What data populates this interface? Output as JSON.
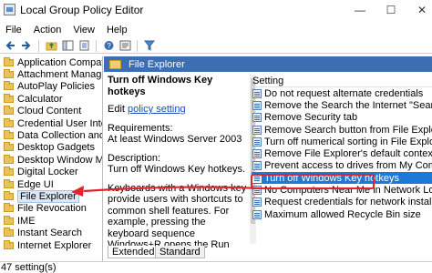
{
  "window": {
    "title": "Local Group Policy Editor",
    "minimize": "—",
    "maximize": "☐",
    "close": "✕"
  },
  "menu": [
    "File",
    "Action",
    "View",
    "Help"
  ],
  "toolbar": {
    "buttons": [
      "back",
      "forward",
      "up",
      "show-hide-tree",
      "export-list",
      "properties",
      "help",
      "filter"
    ]
  },
  "tree": {
    "items": [
      "Application Compati",
      "Attachment Manager",
      "AutoPlay Policies",
      "Calculator",
      "Cloud Content",
      "Credential User Interf",
      "Data Collection and P",
      "Desktop Gadgets",
      "Desktop Window Mai",
      "Digital Locker",
      "Edge UI",
      "File Explorer",
      "File Revocation",
      "IME",
      "Instant Search",
      "Internet Explorer"
    ],
    "selected_index": 11
  },
  "panel": {
    "header": "File Explorer",
    "policy_title": "Turn off Windows Key hotkeys",
    "edit_prefix": "Edit ",
    "edit_link": "policy setting",
    "requirements_label": "Requirements:",
    "requirements_value": "At least Windows Server 2003",
    "description_label": "Description:",
    "description_value": "Turn off Windows Key hotkeys.",
    "body": "Keyboards with a Windows key provide users with shortcuts to common shell features. For example, pressing the keyboard sequence Windows+R opens the Run dialog box; pressing Windows+E starts File Explorer. By"
  },
  "settings": {
    "column_header": "Setting",
    "rows": [
      "Do not request alternate credentials",
      "Remove the Search the Internet \"Search again\"",
      "Remove Security tab",
      "Remove Search button from File Explorer",
      "Turn off numerical sorting in File Explorer",
      "Remove File Explorer's default context menu",
      "Prevent access to drives from My Computer",
      "Turn off Windows Key hotkeys",
      "No Computers Near Me in Network Location",
      "Request credentials for network installations",
      "Maximum allowed Recycle Bin size"
    ],
    "selected_index": 7
  },
  "tabs": [
    "Extended",
    "Standard"
  ],
  "status": "47 setting(s)",
  "colors": {
    "header_blue": "#3c6eb4",
    "selection_blue": "#1e78d6",
    "annotation_red": "#e2232a"
  }
}
